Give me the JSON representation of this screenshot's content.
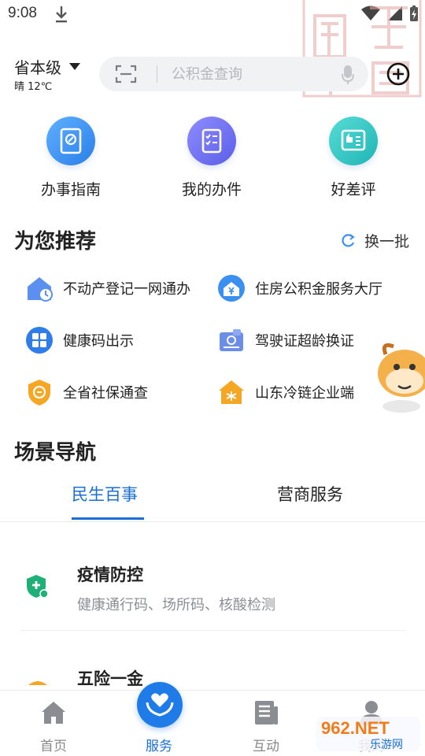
{
  "status_bar": {
    "time": "9:08"
  },
  "header": {
    "region": "省本级",
    "weather": "晴 12℃",
    "search_placeholder": "公积金查询"
  },
  "quick_actions": [
    {
      "label": "办事指南",
      "icon": "compass-book-icon",
      "color": "#3a8ff0"
    },
    {
      "label": "我的办件",
      "icon": "checklist-icon",
      "color": "#6b6ef2"
    },
    {
      "label": "好差评",
      "icon": "thumbs-up-card-icon",
      "color": "#2fc3c0"
    }
  ],
  "recommend": {
    "title": "为您推荐",
    "refresh_label": "换一批",
    "items": [
      {
        "label": "不动产登记一网通办",
        "icon": "house-clock-icon"
      },
      {
        "label": "住房公积金服务大厅",
        "icon": "house-yen-icon"
      },
      {
        "label": "健康码出示",
        "icon": "grid-app-icon"
      },
      {
        "label": "驾驶证超龄换证",
        "icon": "license-card-icon"
      },
      {
        "label": "全省社保通查",
        "icon": "shield-badge-icon"
      },
      {
        "label": "山东冷链企业端",
        "icon": "snowflake-house-icon"
      }
    ]
  },
  "scene_nav": {
    "title": "场景导航",
    "tabs": [
      {
        "label": "民生百事",
        "active": true
      },
      {
        "label": "营商服务",
        "active": false
      }
    ],
    "items": [
      {
        "title": "疫情防控",
        "desc": "健康通行码、场所码、核酸检测",
        "icon": "medical-shield-icon"
      },
      {
        "title": "五险一金",
        "desc": "",
        "icon": "umbrella-icon"
      }
    ]
  },
  "bottom_nav": [
    {
      "label": "首页",
      "icon": "home-icon",
      "active": false
    },
    {
      "label": "服务",
      "icon": "heart-hands-icon",
      "active": true
    },
    {
      "label": "互动",
      "icon": "news-icon",
      "active": false
    },
    {
      "label": "我的",
      "icon": "user-icon",
      "active": false
    }
  ],
  "brand_watermark": {
    "text": "962.NET",
    "sub": "乐游网"
  },
  "colors": {
    "accent": "#1a6fd6",
    "muted": "#8c8f94"
  }
}
